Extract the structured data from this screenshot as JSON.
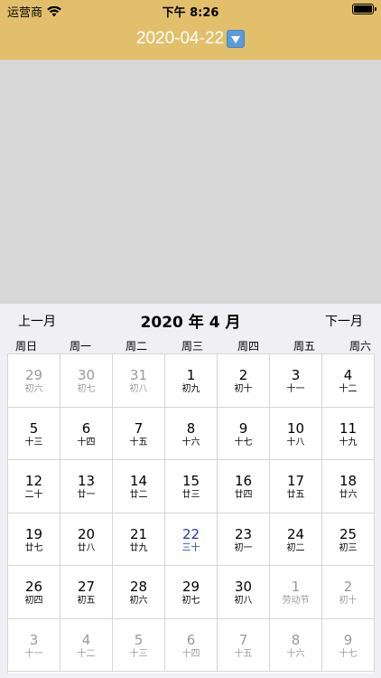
{
  "status_bar": {
    "carrier": "运营商",
    "time": "下午 8:26",
    "battery_level": 1.0
  },
  "nav": {
    "title": "2020-04-22",
    "dropdown_icon": "down-arrow-icon"
  },
  "calendar": {
    "prev_label": "上一月",
    "title": "2020 年 4 月",
    "next_label": "下一月",
    "weekdays": [
      "周日",
      "周一",
      "周二",
      "周三",
      "周四",
      "周五",
      "周六"
    ],
    "today_color": "#2433c9",
    "dim_color": "#9a9a9a",
    "days": [
      {
        "day": "29",
        "lunar": "初六",
        "dim": true
      },
      {
        "day": "30",
        "lunar": "初七",
        "dim": true
      },
      {
        "day": "31",
        "lunar": "初八",
        "dim": true
      },
      {
        "day": "1",
        "lunar": "初九"
      },
      {
        "day": "2",
        "lunar": "初十"
      },
      {
        "day": "3",
        "lunar": "十一"
      },
      {
        "day": "4",
        "lunar": "十二"
      },
      {
        "day": "5",
        "lunar": "十三"
      },
      {
        "day": "6",
        "lunar": "十四"
      },
      {
        "day": "7",
        "lunar": "十五"
      },
      {
        "day": "8",
        "lunar": "十六"
      },
      {
        "day": "9",
        "lunar": "十七"
      },
      {
        "day": "10",
        "lunar": "十八"
      },
      {
        "day": "11",
        "lunar": "十九"
      },
      {
        "day": "12",
        "lunar": "二十"
      },
      {
        "day": "13",
        "lunar": "廿一"
      },
      {
        "day": "14",
        "lunar": "廿二"
      },
      {
        "day": "15",
        "lunar": "廿三"
      },
      {
        "day": "16",
        "lunar": "廿四"
      },
      {
        "day": "17",
        "lunar": "廿五"
      },
      {
        "day": "18",
        "lunar": "廿六"
      },
      {
        "day": "19",
        "lunar": "廿七"
      },
      {
        "day": "20",
        "lunar": "廿八"
      },
      {
        "day": "21",
        "lunar": "廿九"
      },
      {
        "day": "22",
        "lunar": "三十",
        "today": true
      },
      {
        "day": "23",
        "lunar": "初一"
      },
      {
        "day": "24",
        "lunar": "初二"
      },
      {
        "day": "25",
        "lunar": "初三"
      },
      {
        "day": "26",
        "lunar": "初四"
      },
      {
        "day": "27",
        "lunar": "初五"
      },
      {
        "day": "28",
        "lunar": "初六"
      },
      {
        "day": "29",
        "lunar": "初七"
      },
      {
        "day": "30",
        "lunar": "初八"
      },
      {
        "day": "1",
        "lunar": "劳动节",
        "dim": true
      },
      {
        "day": "2",
        "lunar": "初十",
        "dim": true
      },
      {
        "day": "3",
        "lunar": "十一",
        "dim": true
      },
      {
        "day": "4",
        "lunar": "十二",
        "dim": true
      },
      {
        "day": "5",
        "lunar": "十三",
        "dim": true
      },
      {
        "day": "6",
        "lunar": "十四",
        "dim": true
      },
      {
        "day": "7",
        "lunar": "十五",
        "dim": true
      },
      {
        "day": "8",
        "lunar": "十六",
        "dim": true
      },
      {
        "day": "9",
        "lunar": "十七",
        "dim": true
      }
    ]
  }
}
